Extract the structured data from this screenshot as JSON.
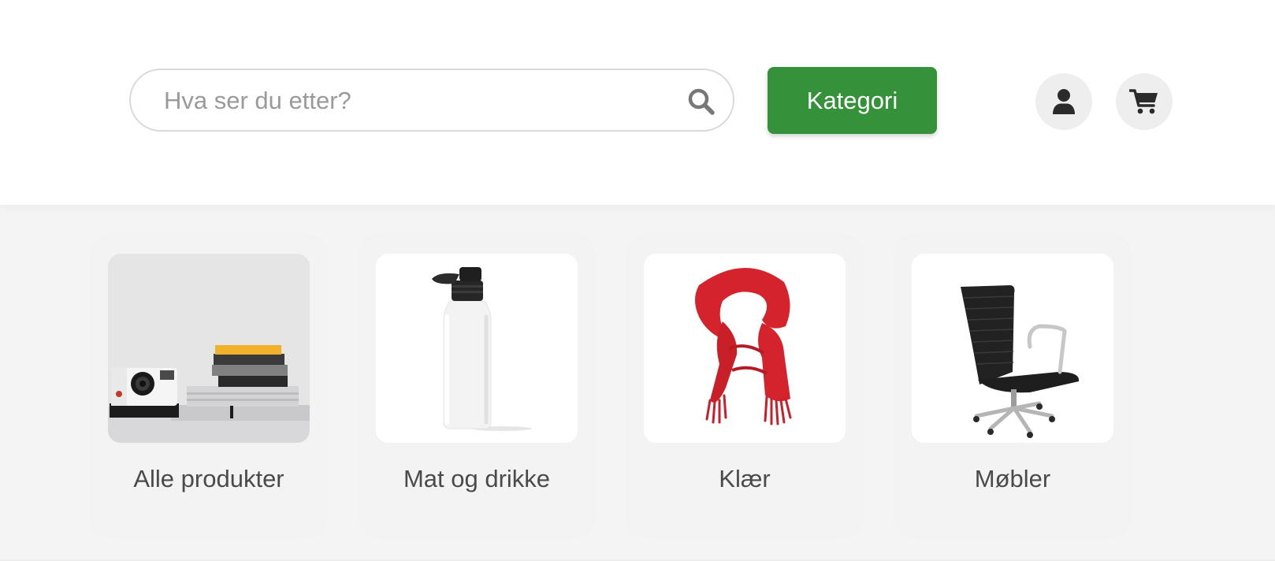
{
  "header": {
    "search": {
      "placeholder": "Hva ser du etter?",
      "value": "",
      "icon": "search-icon"
    },
    "category_button_label": "Kategori",
    "account_icon": "user-icon",
    "cart_icon": "cart-icon",
    "colors": {
      "accent": "#35913a",
      "header_bg": "#ffffff",
      "page_bg": "#f4f4f4"
    }
  },
  "categories": [
    {
      "label": "Alle produkter",
      "image": "camera-and-books-image"
    },
    {
      "label": "Mat og drikke",
      "image": "water-bottle-image"
    },
    {
      "label": "Klær",
      "image": "red-scarf-image"
    },
    {
      "label": "Møbler",
      "image": "office-chair-image"
    }
  ]
}
